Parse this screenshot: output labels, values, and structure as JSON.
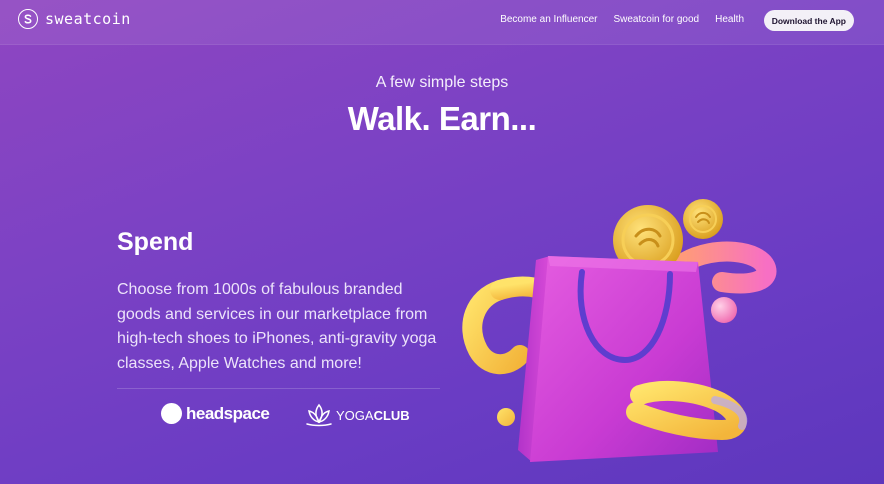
{
  "nav": {
    "logo_text": "sweatcoin",
    "links": [
      "Become an Influencer",
      "Sweatcoin for good",
      "Health"
    ],
    "cta_label": "Download the App"
  },
  "hero": {
    "subtitle": "A few simple steps",
    "headline": "Walk. Earn..."
  },
  "section": {
    "title": "Spend",
    "body": "Choose from 1000s of fabulous branded goods and services in our marketplace from high-tech shoes to iPhones, anti-gravity yoga classes, Apple Watches and more!"
  },
  "partners": {
    "headspace": "headspace",
    "yoga_prefix": "YOGA",
    "yoga_suffix": "CLUB"
  },
  "icons": [
    "sweatcoin-logo-icon",
    "headspace-logo-icon",
    "yogaclub-lotus-icon",
    "shopping-bag-illustration",
    "coin-icon"
  ],
  "colors": {
    "background": "#7c42c4",
    "cta_bg": "#f3f0f7",
    "bag": "#d23fd6",
    "coin": "#f0c23a"
  }
}
